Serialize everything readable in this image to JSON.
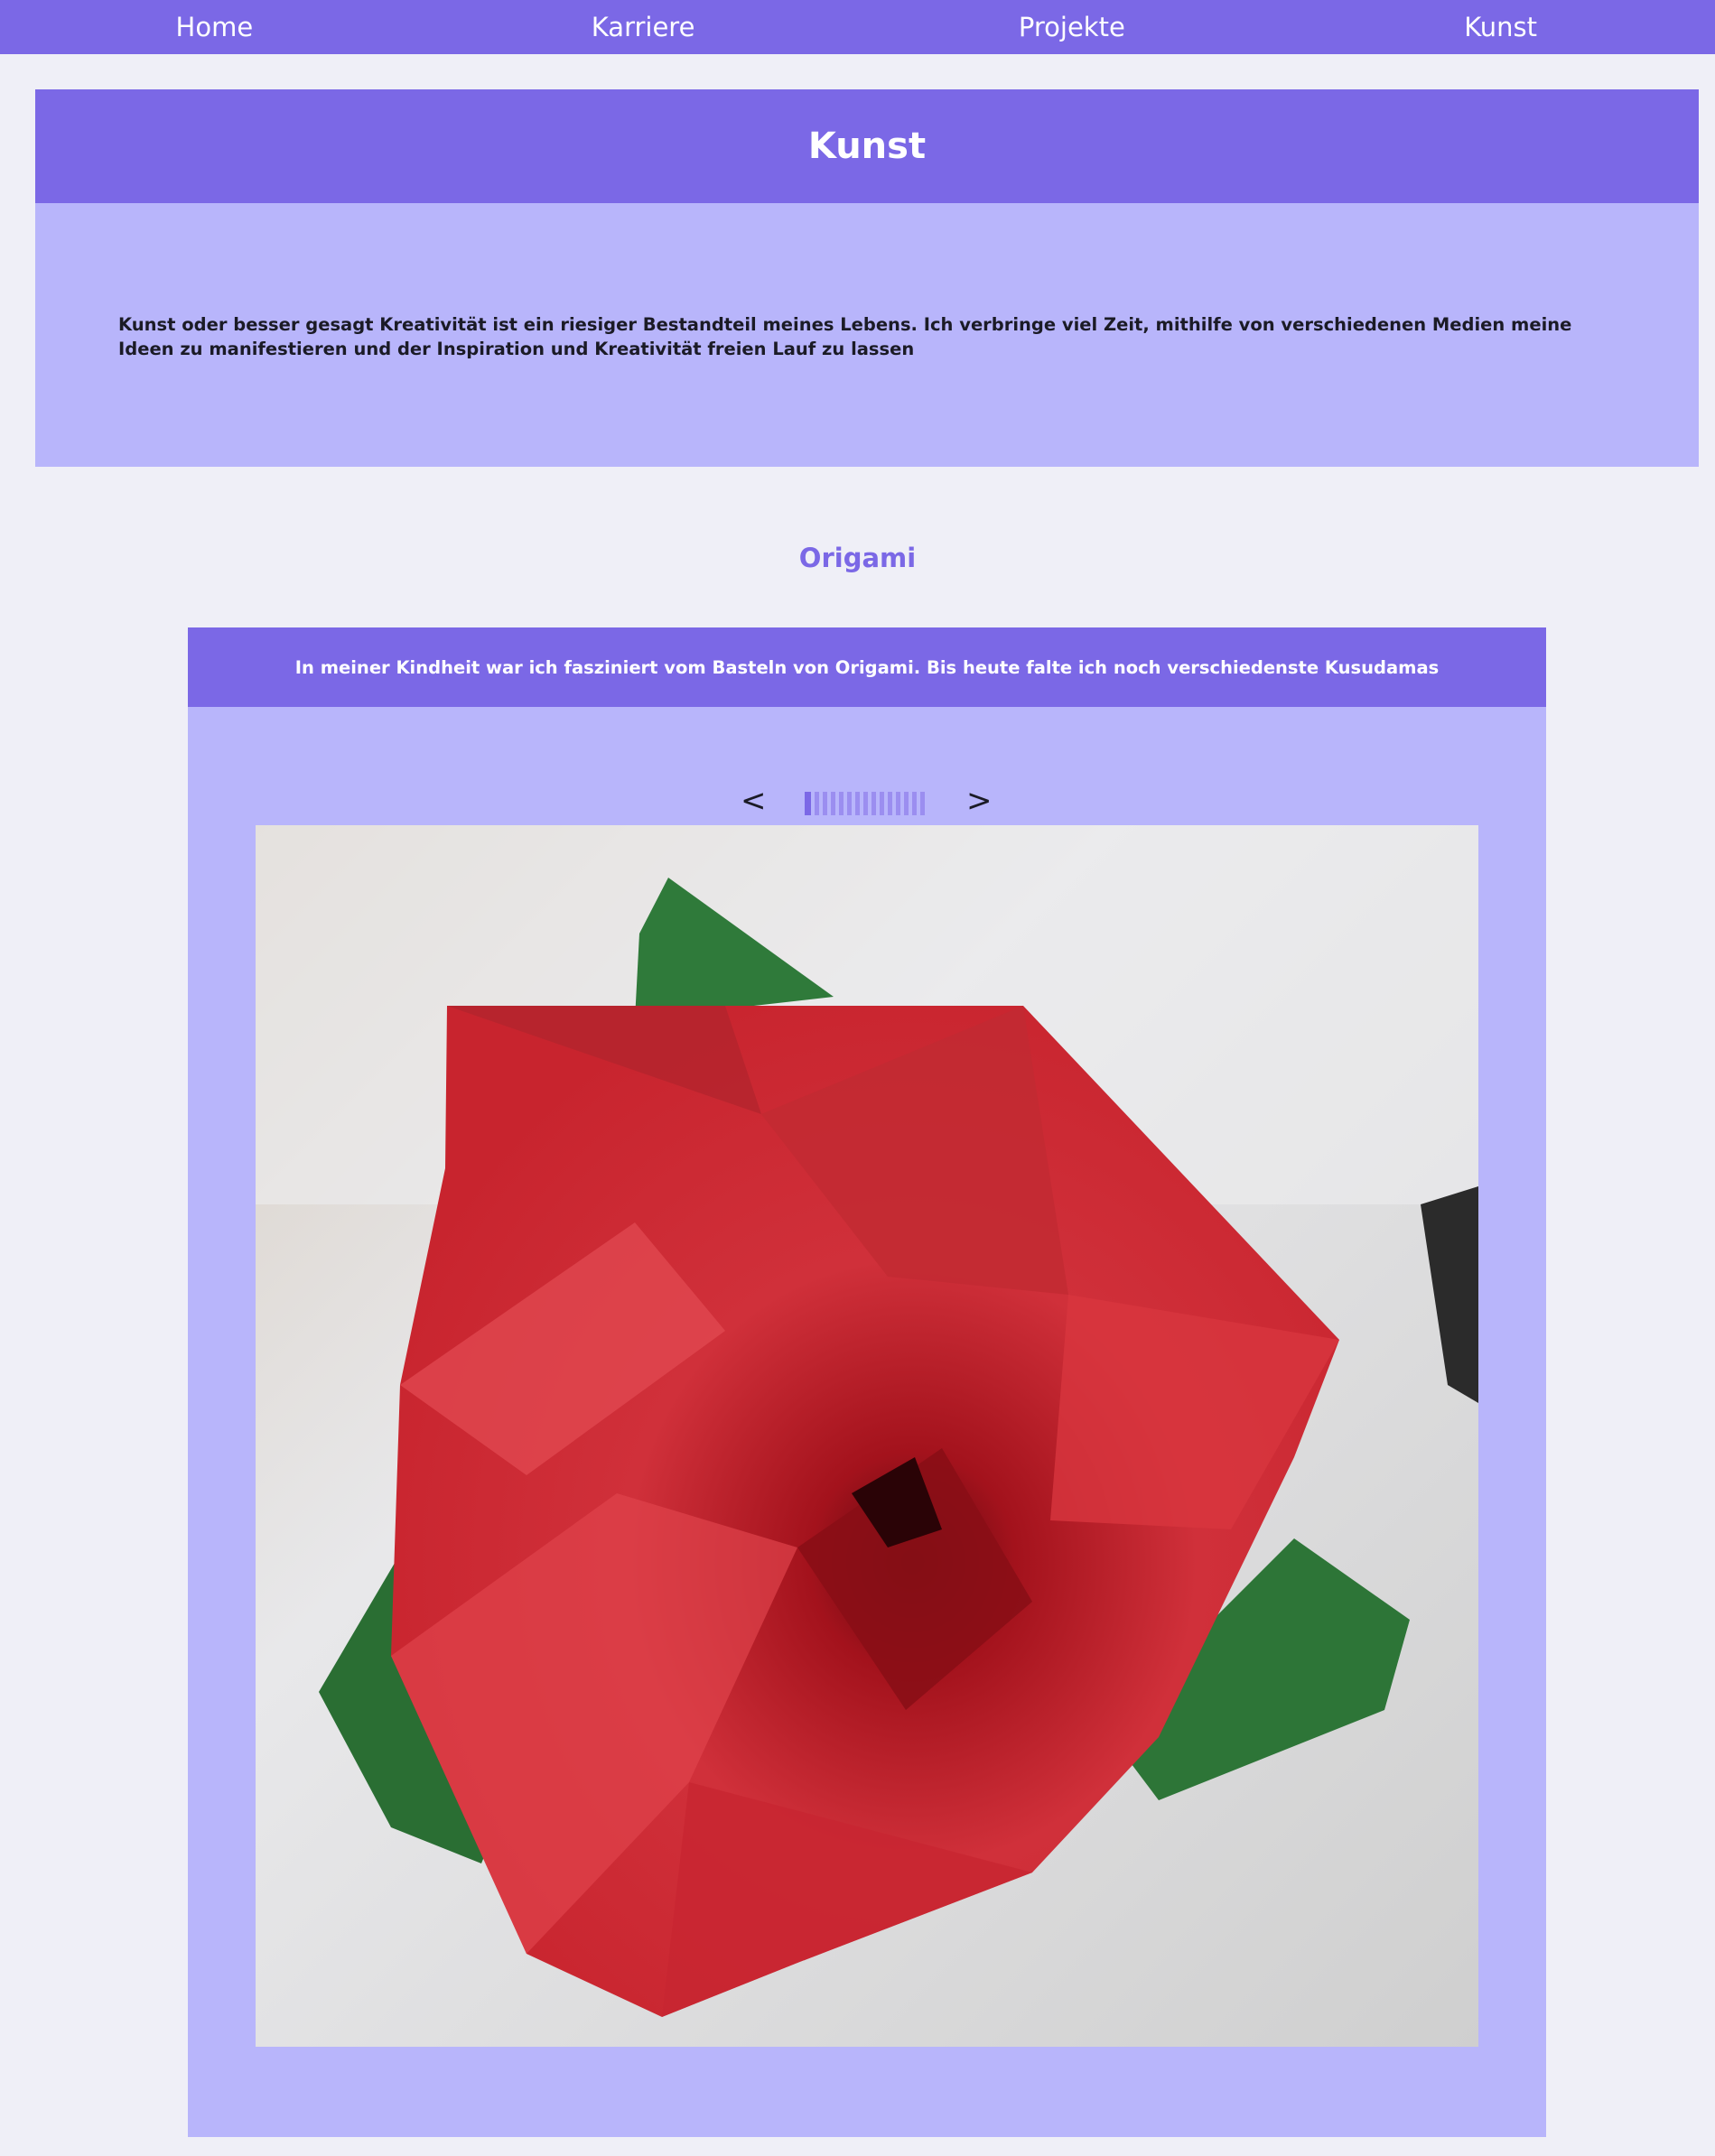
{
  "nav": {
    "items": [
      "Home",
      "Karriere",
      "Projekte",
      "Kunst"
    ]
  },
  "intro": {
    "title": "Kunst",
    "text": "Kunst oder besser gesagt Kreativität ist ein riesiger Bestandteil meines Lebens. Ich verbringe viel Zeit, mithilfe von verschiedenen Medien meine Ideen zu manifestieren und der Inspiration und Kreativität freien Lauf zu lassen"
  },
  "origami": {
    "title": "Origami",
    "caption": "In meiner Kindheit war ich fasziniert vom Basteln von Origami. Bis heute falte ich noch verschiedenste Kusudamas",
    "prev_label": "<",
    "next_label": ">",
    "slide_count": 15,
    "active_slide": 1
  },
  "colors": {
    "accent": "#7b68e6",
    "panel": "#b8b5fb",
    "background": "#efeff7"
  }
}
